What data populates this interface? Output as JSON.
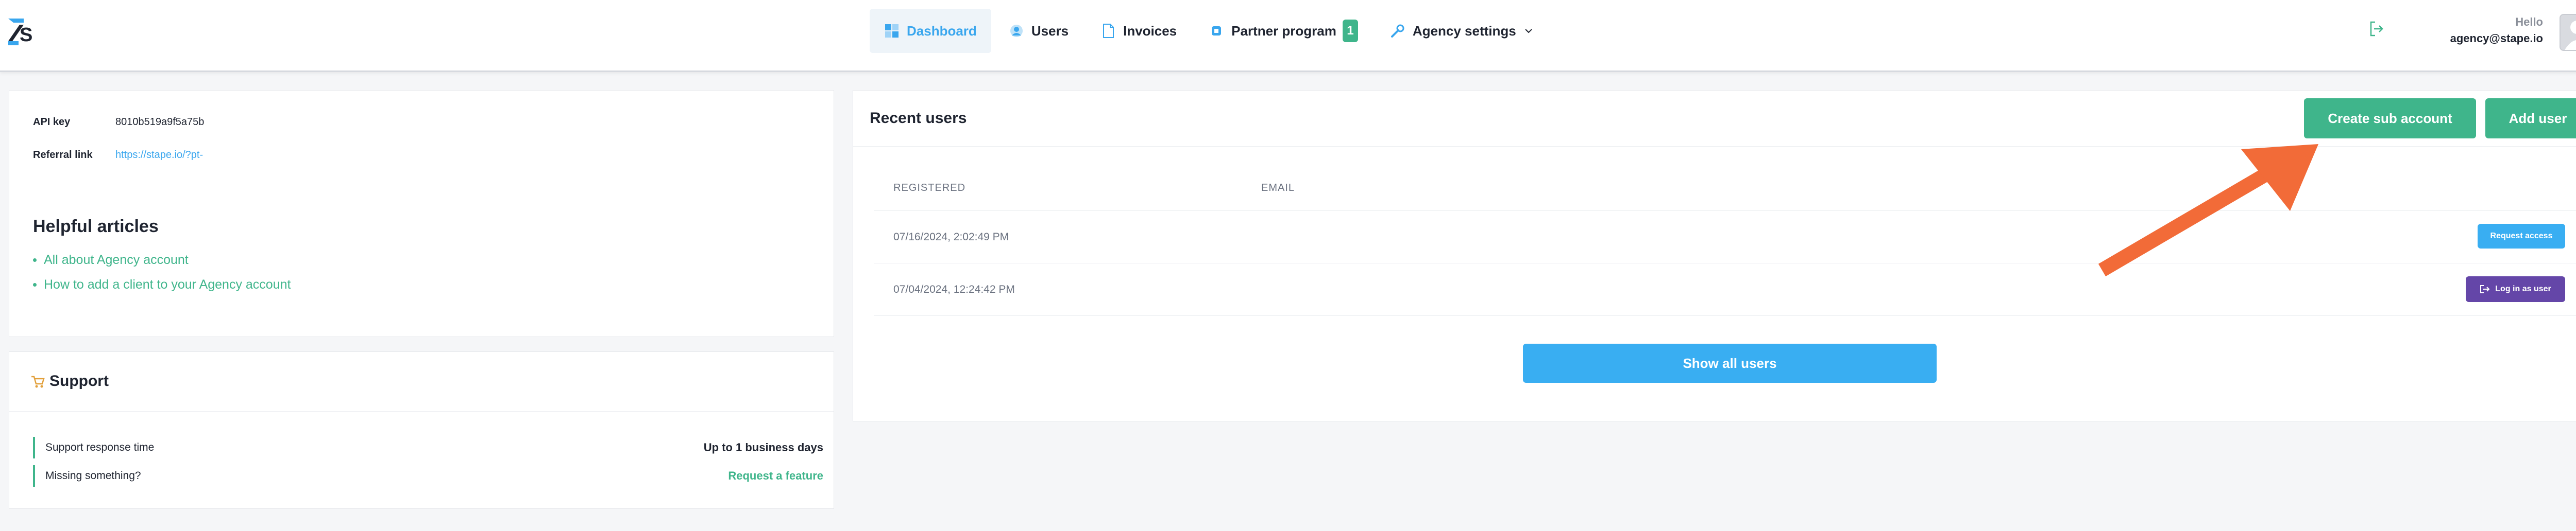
{
  "header": {
    "nav": [
      {
        "label": "Dashboard",
        "icon": "dashboard-icon"
      },
      {
        "label": "Users",
        "icon": "users-icon"
      },
      {
        "label": "Invoices",
        "icon": "invoices-icon"
      },
      {
        "label": "Partner program",
        "icon": "partner-icon",
        "badge": "1"
      },
      {
        "label": "Agency settings",
        "icon": "wrench-icon"
      }
    ],
    "greeting": "Hello",
    "email": "agency@stape.io"
  },
  "info": {
    "api_key_label": "API key",
    "api_key_value": "8010b519a9f5a75b",
    "referral_label": "Referral link",
    "referral_value": "https://stape.io/?pt-",
    "helpful_title": "Helpful articles",
    "articles": [
      "All about Agency account",
      "How to add a client to your Agency account"
    ]
  },
  "support": {
    "title": "Support",
    "rows": [
      {
        "label": "Support response time",
        "value": "Up to 1 business days"
      },
      {
        "label": "Missing something?",
        "value": "Request a feature"
      }
    ]
  },
  "users": {
    "title": "Recent users",
    "create_sub_account": "Create sub account",
    "add_user": "Add user",
    "columns": [
      "REGISTERED",
      "EMAIL"
    ],
    "rows": [
      {
        "registered": "07/16/2024, 2:02:49 PM",
        "action": "Request access"
      },
      {
        "registered": "07/04/2024, 12:24:42 PM",
        "action": "Log in as user"
      }
    ],
    "show_all": "Show all users"
  },
  "colors": {
    "accent_blue": "#39a6ee",
    "accent_green": "#3fb58b",
    "purple": "#6446a8",
    "arrow": "#f26b38"
  }
}
